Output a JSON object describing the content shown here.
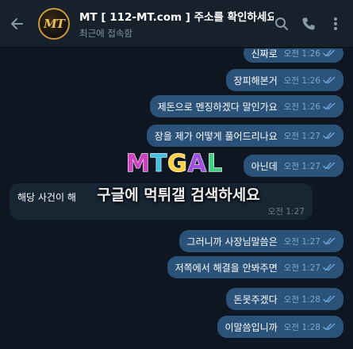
{
  "header": {
    "avatar_text": "MT",
    "title": "MT [ 112-MT.com ] 주소를 확인하세요",
    "subtitle": "최근에 접속함",
    "back_icon": "arrow-left-icon",
    "search_icon": "search-icon",
    "call_icon": "phone-icon",
    "menu_icon": "more-vertical-icon"
  },
  "messages": [
    {
      "text": "신짜로",
      "time": "오전 1:26",
      "dir": "out"
    },
    {
      "text": "장피해본거",
      "time": "오전 1:26",
      "dir": "out"
    },
    {
      "text": "제돈으로 멘징하겠다 말인가요",
      "time": "오전 1:26",
      "dir": "out"
    },
    {
      "text": "장을 제가 어떻게 풀어드리나요",
      "time": "오전 1:27",
      "dir": "out"
    },
    {
      "text": "아닌데",
      "time": "오전 1:27",
      "dir": "out"
    },
    {
      "text": "해당 사건이 해",
      "time": "오전 1:27",
      "dir": "in"
    },
    {
      "text": "그러니까 사장님말씀은",
      "time": "오전 1:27",
      "dir": "out"
    },
    {
      "text": "저쪽에서 해결을 안봐주면",
      "time": "오전 1:27",
      "dir": "out"
    },
    {
      "text": "돈못주겠다",
      "time": "오전 1:28",
      "dir": "out"
    },
    {
      "text": "이말씀입니까",
      "time": "오전 1:28",
      "dir": "out"
    }
  ],
  "watermark": {
    "logo_text": "MTGAL",
    "text": "구글에 먹튀갤 검색하세요"
  },
  "colors": {
    "background": "#0e1621",
    "header": "#17212b",
    "outgoing": "#2b5278",
    "incoming": "#182533",
    "check": "#6aa2d8"
  }
}
